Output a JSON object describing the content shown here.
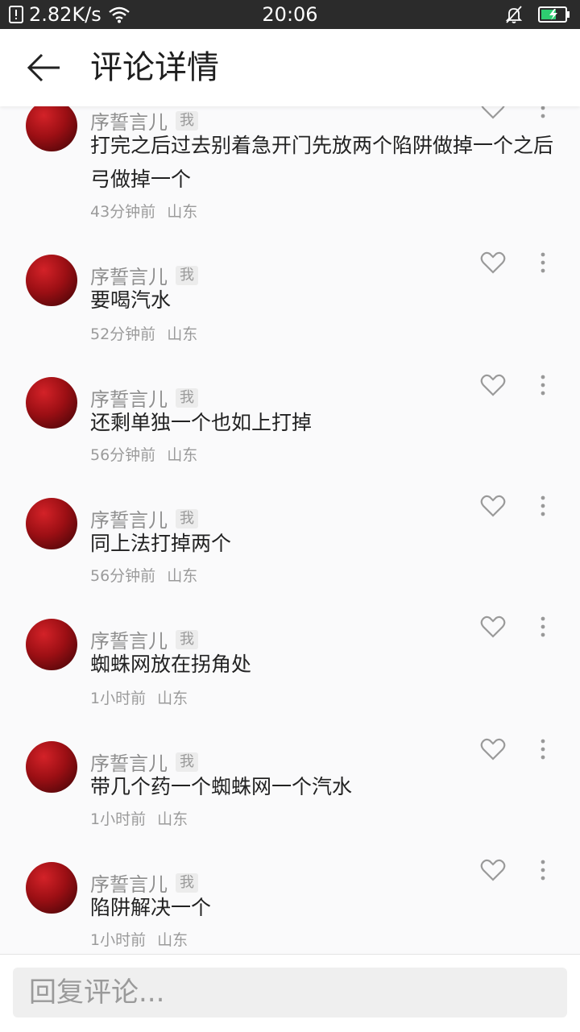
{
  "status_bar": {
    "net_speed": "2.82K/s",
    "time": "20:06",
    "battery_color": "#2ecc71"
  },
  "header": {
    "title": "评论详情"
  },
  "comments": [
    {
      "user": "序誓言儿",
      "badge": "我",
      "text": "打完之后过去别着急开门先放两个陷阱做掉一个之后弓做掉一个",
      "time": "43分钟前",
      "location": "山东"
    },
    {
      "user": "序誓言儿",
      "badge": "我",
      "text": "要喝汽水",
      "time": "52分钟前",
      "location": "山东"
    },
    {
      "user": "序誓言儿",
      "badge": "我",
      "text": "还剩单独一个也如上打掉",
      "time": "56分钟前",
      "location": "山东"
    },
    {
      "user": "序誓言儿",
      "badge": "我",
      "text": "同上法打掉两个",
      "time": "56分钟前",
      "location": "山东"
    },
    {
      "user": "序誓言儿",
      "badge": "我",
      "text": "蜘蛛网放在拐角处",
      "time": "1小时前",
      "location": "山东"
    },
    {
      "user": "序誓言儿",
      "badge": "我",
      "text": "带几个药一个蜘蛛网一个汽水",
      "time": "1小时前",
      "location": "山东"
    },
    {
      "user": "序誓言儿",
      "badge": "我",
      "text": "陷阱解决一个",
      "time": "1小时前",
      "location": "山东"
    }
  ],
  "reply_box": {
    "placeholder": "回复评论..."
  }
}
